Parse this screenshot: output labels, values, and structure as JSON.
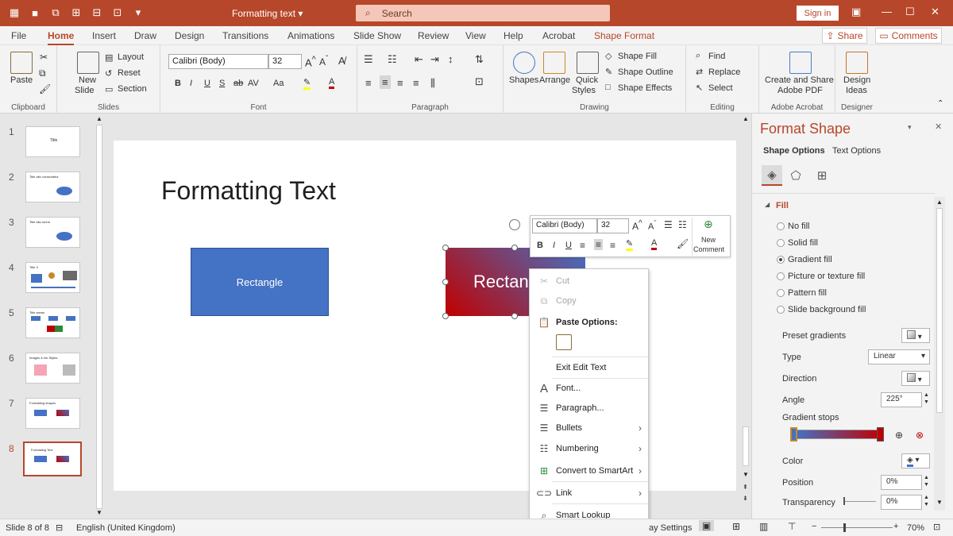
{
  "titlebar": {
    "doc_title": "Formatting text ▾",
    "search_placeholder": "Search",
    "signin_label": "Sign in"
  },
  "menu": {
    "tabs": [
      "File",
      "Home",
      "Insert",
      "Draw",
      "Design",
      "Transitions",
      "Animations",
      "Slide Show",
      "Review",
      "View",
      "Help",
      "Acrobat",
      "Shape Format"
    ],
    "share": "Share",
    "comments": "Comments"
  },
  "ribbon": {
    "clipboard": {
      "label": "Clipboard",
      "paste": "Paste"
    },
    "slides": {
      "label": "Slides",
      "new_slide": "New",
      "new_slide2": "Slide",
      "layout": "Layout",
      "reset": "Reset",
      "section": "Section"
    },
    "font": {
      "label": "Font",
      "name": "Calibri (Body)",
      "size": "32"
    },
    "paragraph": {
      "label": "Paragraph"
    },
    "drawing": {
      "label": "Drawing",
      "shapes": "Shapes",
      "arrange": "Arrange",
      "quick_styles": "Quick",
      "quick_styles2": "Styles",
      "shape_fill": "Shape Fill",
      "shape_outline": "Shape Outline",
      "shape_effects": "Shape Effects"
    },
    "editing": {
      "label": "Editing",
      "find": "Find",
      "replace": "Replace",
      "select": "Select"
    },
    "acrobat": {
      "label": "Adobe Acrobat",
      "create": "Create and Share",
      "create2": "Adobe PDF"
    },
    "designer": {
      "label": "Designer",
      "design": "Design",
      "ideas": "Ideas"
    }
  },
  "thumbnails": [
    {
      "num": "1",
      "text": "Title"
    },
    {
      "num": "2",
      "text": "Title abc consectetur"
    },
    {
      "num": "3",
      "text": "Title abc lorem"
    },
    {
      "num": "4",
      "text": "Title X"
    },
    {
      "num": "5",
      "text": "Title wants"
    },
    {
      "num": "6",
      "text": "Images & Ink Styles"
    },
    {
      "num": "7",
      "text": "Formatting shapes"
    },
    {
      "num": "8",
      "text": "Formatting Text"
    }
  ],
  "slide": {
    "title": "Formatting Text",
    "rect1": "Rectangle",
    "rect2": "Rectan"
  },
  "minitoolbar": {
    "font": "Calibri (Body)",
    "size": "32",
    "new_comment": "New",
    "new_comment2": "Comment"
  },
  "context_menu": {
    "cut": "Cut",
    "copy": "Copy",
    "paste_options": "Paste Options:",
    "exit_edit": "Exit Edit Text",
    "font": "Font...",
    "paragraph": "Paragraph...",
    "bullets": "Bullets",
    "numbering": "Numbering",
    "smartart": "Convert to SmartArt",
    "link": "Link",
    "smart_lookup": "Smart Lookup"
  },
  "panel": {
    "title": "Format Shape",
    "tab_shape": "Shape Options",
    "tab_text": "Text Options",
    "section": "Fill",
    "fill_options": [
      "No fill",
      "Solid fill",
      "Gradient fill",
      "Picture or texture fill",
      "Pattern fill",
      "Slide background fill"
    ],
    "selected_fill": 2,
    "preset": "Preset gradients",
    "type_label": "Type",
    "type_value": "Linear",
    "direction": "Direction",
    "angle_label": "Angle",
    "angle_value": "225°",
    "stops": "Gradient stops",
    "color": "Color",
    "position_label": "Position",
    "position_value": "0%",
    "transparency_label": "Transparency",
    "transparency_value": "0%"
  },
  "status": {
    "slide_of": "Slide 8 of 8",
    "language": "English (United Kingdom)",
    "display": "ay Settings",
    "zoom": "70%"
  },
  "colors": {
    "accent": "#b7472a",
    "rect_blue": "#4472c4",
    "grad_red": "#c00000"
  }
}
